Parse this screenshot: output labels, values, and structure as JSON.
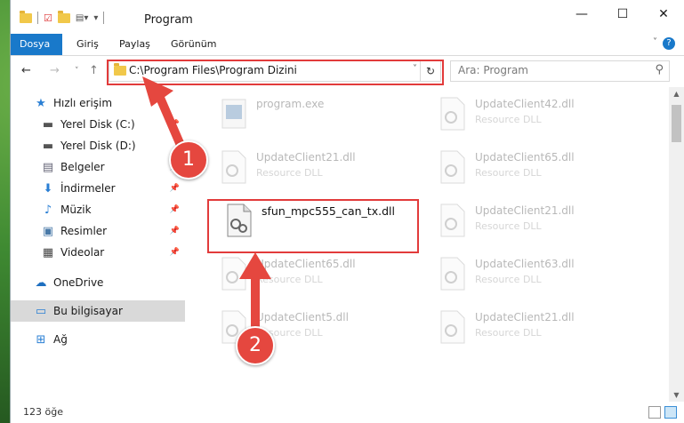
{
  "window": {
    "title": "Program",
    "min": "—",
    "max": "☐",
    "close": "✕"
  },
  "ribbon": {
    "tabs": [
      "Dosya",
      "Giriş",
      "Paylaş",
      "Görünüm"
    ],
    "help": "?"
  },
  "address": {
    "path": "C:\\Program Files\\Program Dizini",
    "search_placeholder": "Ara: Program"
  },
  "sidebar": {
    "items": [
      {
        "label": "Hızlı erişim",
        "icon": "star-icon"
      },
      {
        "label": "Yerel Disk (C:)",
        "icon": "drive-icon"
      },
      {
        "label": "Yerel Disk (D:)",
        "icon": "drive-icon"
      },
      {
        "label": "Belgeler",
        "icon": "documents-icon"
      },
      {
        "label": "İndirmeler",
        "icon": "download-icon"
      },
      {
        "label": "Müzik",
        "icon": "music-icon"
      },
      {
        "label": "Resimler",
        "icon": "pictures-icon"
      },
      {
        "label": "Videolar",
        "icon": "videos-icon"
      },
      {
        "label": "OneDrive",
        "icon": "cloud-icon"
      },
      {
        "label": "Bu bilgisayar",
        "icon": "computer-icon"
      },
      {
        "label": "Ağ",
        "icon": "network-icon"
      }
    ]
  },
  "files": {
    "highlighted": {
      "name": "sfun_mpc555_can_tx.dll"
    },
    "left": [
      {
        "name": "program.exe",
        "type": ""
      },
      {
        "name": "UpdateClient21.dll",
        "type": "Resource DLL"
      },
      {
        "name": "UpdateClient65.dll",
        "type": "Resource DLL"
      },
      {
        "name": "UpdateClient5.dll",
        "type": "Resource DLL"
      }
    ],
    "right": [
      {
        "name": "UpdateClient42.dll",
        "type": "Resource DLL"
      },
      {
        "name": "UpdateClient65.dll",
        "type": "Resource DLL"
      },
      {
        "name": "UpdateClient21.dll",
        "type": "Resource DLL"
      },
      {
        "name": "UpdateClient63.dll",
        "type": "Resource DLL"
      },
      {
        "name": "UpdateClient21.dll",
        "type": "Resource DLL"
      }
    ]
  },
  "status": {
    "count": "123 öğe"
  },
  "annotations": {
    "step1": "1",
    "step2": "2"
  },
  "colors": {
    "accent": "#1979ca",
    "highlight": "#e23b3b",
    "badge": "#e5473f"
  }
}
